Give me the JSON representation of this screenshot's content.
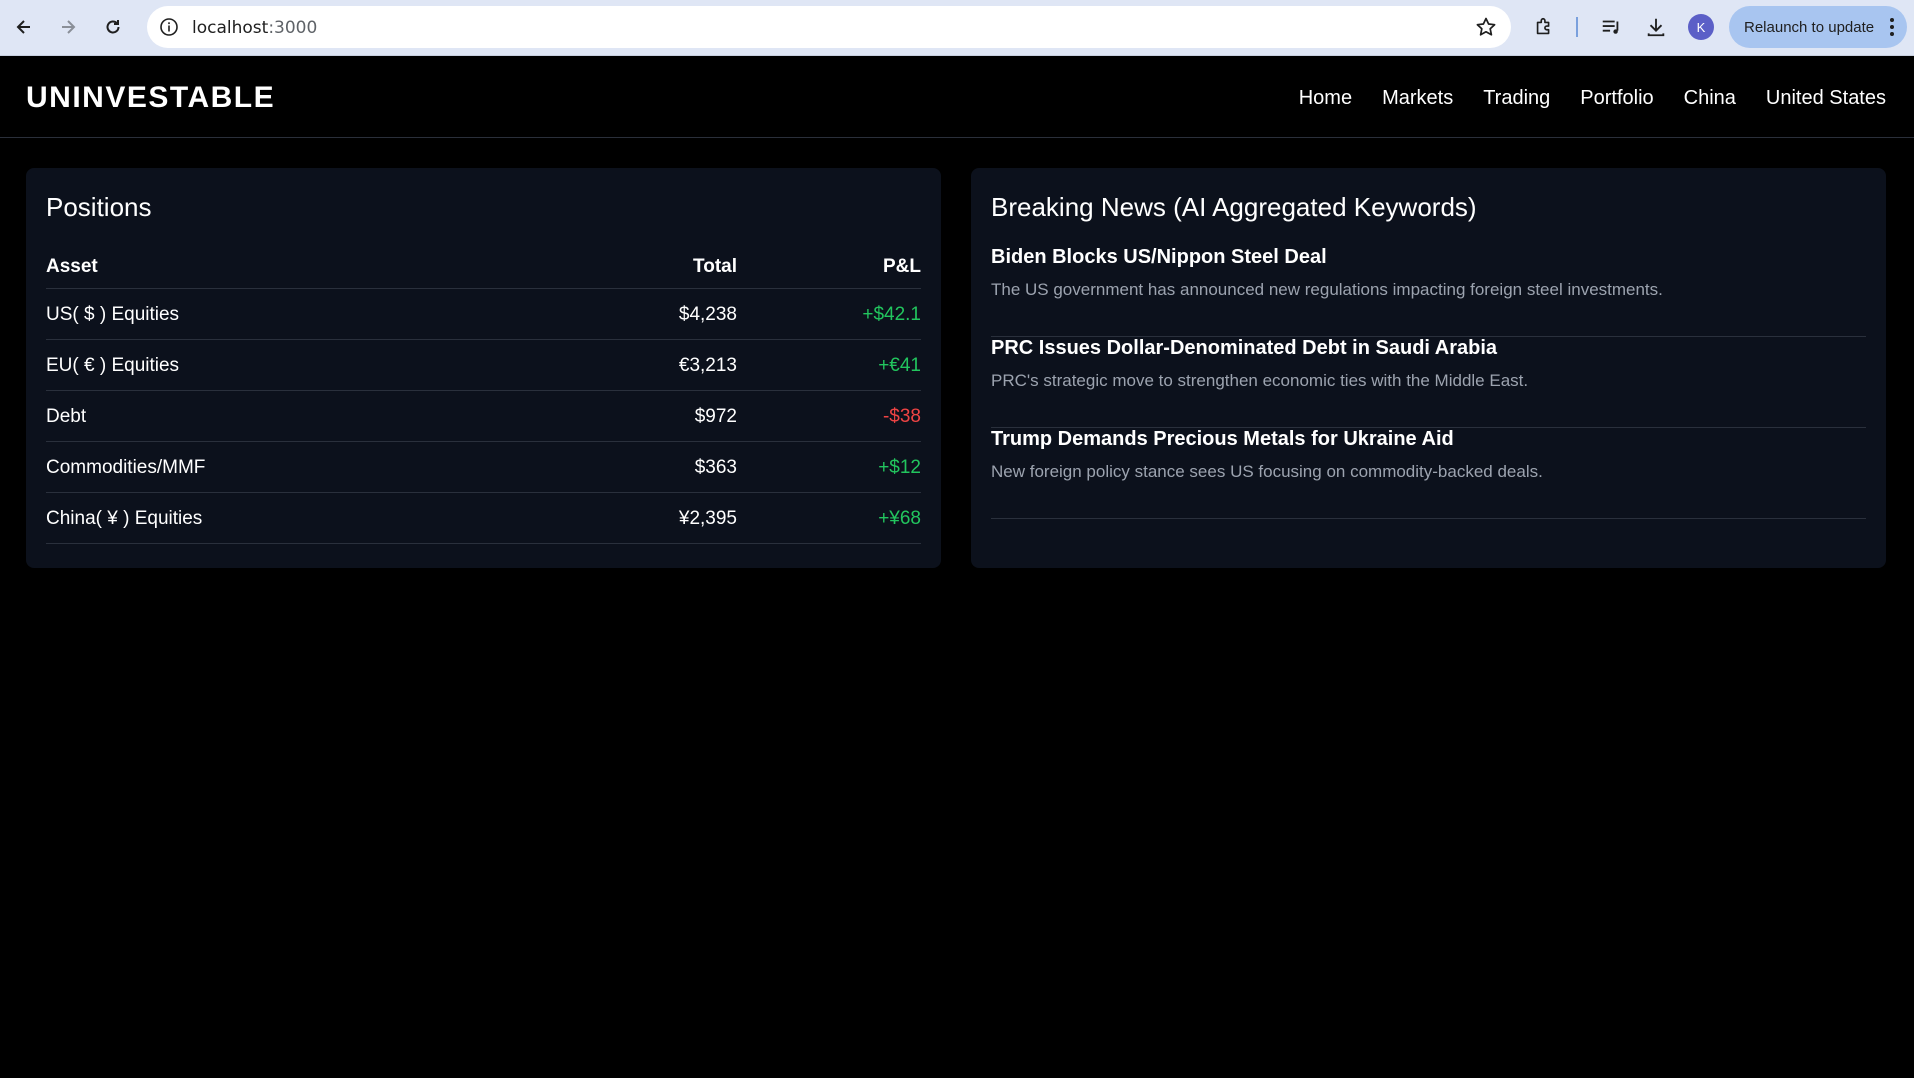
{
  "browser": {
    "url_host": "localhost",
    "url_port": ":3000",
    "avatar_letter": "K",
    "relaunch_label": "Relaunch to update"
  },
  "site": {
    "brand": "UNINVESTABLE",
    "nav": [
      "Home",
      "Markets",
      "Trading",
      "Portfolio",
      "China",
      "United States"
    ]
  },
  "positions": {
    "title": "Positions",
    "headers": {
      "asset": "Asset",
      "total": "Total",
      "pl": "P&L"
    },
    "rows": [
      {
        "asset": "US( $ ) Equities",
        "total": "$4,238",
        "pl": "+$42.1",
        "direction": "up"
      },
      {
        "asset": "EU( € ) Equities",
        "total": "€3,213",
        "pl": "+€41",
        "direction": "up"
      },
      {
        "asset": "Debt",
        "total": "$972",
        "pl": "-$38",
        "direction": "down"
      },
      {
        "asset": "Commodities/MMF",
        "total": "$363",
        "pl": "+$12",
        "direction": "up"
      },
      {
        "asset": "China( ¥ ) Equities",
        "total": "¥2,395",
        "pl": "+¥68",
        "direction": "up"
      }
    ]
  },
  "news": {
    "title": "Breaking News (AI Aggregated Keywords)",
    "items": [
      {
        "headline": "Biden Blocks US/Nippon Steel Deal",
        "description": "The US government has announced new regulations impacting foreign steel investments."
      },
      {
        "headline": "PRC Issues Dollar-Denominated Debt in Saudi Arabia",
        "description": "PRC's strategic move to strengthen economic ties with the Middle East."
      },
      {
        "headline": "Trump Demands Precious Metals for Ukraine Aid",
        "description": "New foreign policy stance sees US focusing on commodity-backed deals."
      }
    ]
  },
  "colors": {
    "positive": "#22c55e",
    "negative": "#ef4444",
    "card_bg": "#0c111c",
    "page_bg": "#000000"
  }
}
